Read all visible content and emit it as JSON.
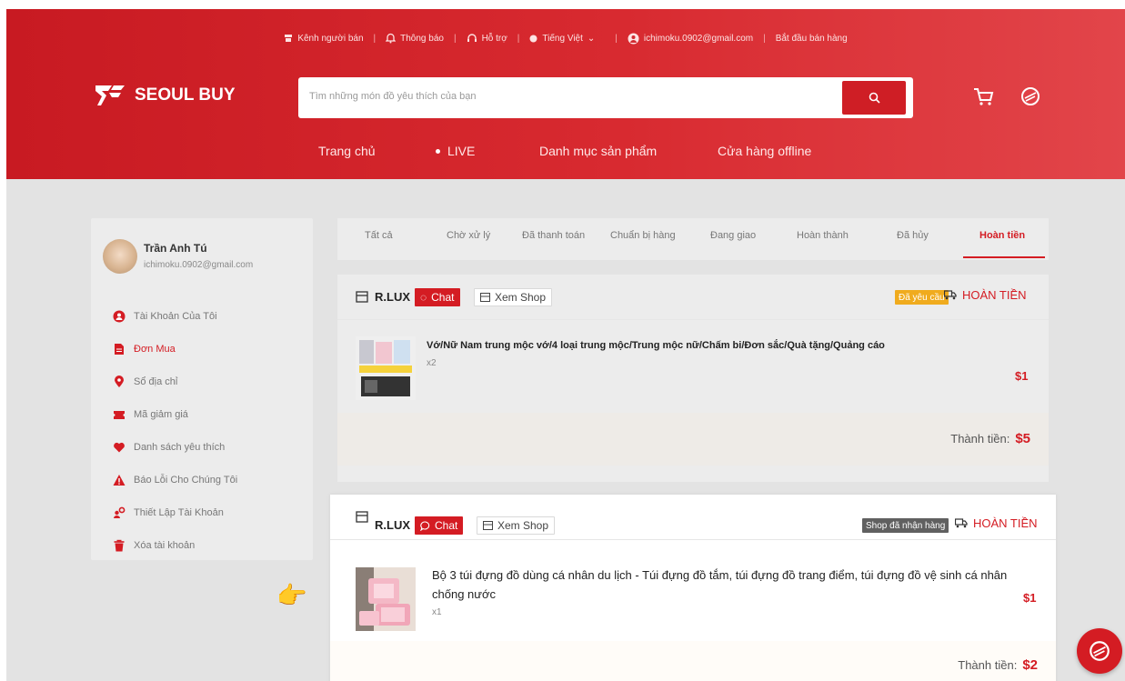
{
  "colors": {
    "brand": "#d41c23",
    "header_start": "#c81a22",
    "header_end": "#e2454a",
    "page_bg": "#e3e3e3",
    "pending_badge": "#f0ab1e",
    "received_badge": "#606060"
  },
  "topbar": {
    "seller_channel": "Kênh người bán",
    "notifications": "Thông báo",
    "support": "Hỗ trợ",
    "language": "Tiếng Việt",
    "email": "ichimoku.0902@gmail.com",
    "start_selling": "Bắt đầu bán hàng"
  },
  "header": {
    "logo_text": "SEOUL BUY",
    "search_placeholder": "Tìm những món đồ yêu thích của bạn",
    "icons": [
      "search-icon",
      "cart-icon",
      "chat-bubble-icon"
    ]
  },
  "nav": {
    "home": "Trang chủ",
    "live": "LIVE",
    "categories": "Danh mục sản phẩm",
    "offline_stores": "Cửa hàng offline"
  },
  "user": {
    "name": "Trần Anh Tú",
    "email": "ichimoku.0902@gmail.com"
  },
  "sidebar": {
    "items": [
      {
        "label": "Tài Khoản Của Tôi",
        "icon": "user-icon"
      },
      {
        "label": "Đơn Mua",
        "icon": "document-icon",
        "active": true
      },
      {
        "label": "Sổ địa chỉ",
        "icon": "location-pin-icon"
      },
      {
        "label": "Mã giảm giá",
        "icon": "ticket-icon"
      },
      {
        "label": "Danh sách yêu thích",
        "icon": "heart-icon"
      },
      {
        "label": "Báo Lỗi Cho Chúng Tôi",
        "icon": "warning-icon"
      },
      {
        "label": "Thiết Lập Tài Khoản",
        "icon": "people-settings-icon"
      },
      {
        "label": "Xóa tài khoản",
        "icon": "trash-icon"
      }
    ]
  },
  "tabs": [
    {
      "label": "Tất cả"
    },
    {
      "label": "Chờ xử lý"
    },
    {
      "label": "Đã thanh toán"
    },
    {
      "label": "Chuẩn bị hàng"
    },
    {
      "label": "Đang giao"
    },
    {
      "label": "Hoàn thành"
    },
    {
      "label": "Đã hủy"
    },
    {
      "label": "Hoàn tiền",
      "active": true
    }
  ],
  "orders": [
    {
      "shop": "R.LUX",
      "chat_label": "Chat",
      "view_shop_label": "Xem Shop",
      "badge": "Đã yêu cầu",
      "status": "HOÀN TIỀN",
      "product_name": "Vớ/Nữ Nam trung mộc vớ/4 loại trung mộc/Trung mộc nữ/Chấm bi/Đơn sắc/Quà tặng/Quảng cáo",
      "qty": "x2",
      "price": "$1",
      "total_label": "Thành tiền:",
      "total": "$5"
    },
    {
      "shop": "R.LUX",
      "chat_label": "Chat",
      "view_shop_label": "Xem Shop",
      "badge": "Shop đã nhận hàng",
      "status": "HOÀN TIỀN",
      "product_name": "Bộ 3 túi đựng đồ dùng cá nhân du lịch - Túi đựng đồ tắm, túi đựng đồ trang điểm, túi đựng đồ vệ sinh cá nhân chống nước",
      "qty": "x1",
      "price": "$1",
      "total_label": "Thành tiền:",
      "total": "$2"
    }
  ]
}
